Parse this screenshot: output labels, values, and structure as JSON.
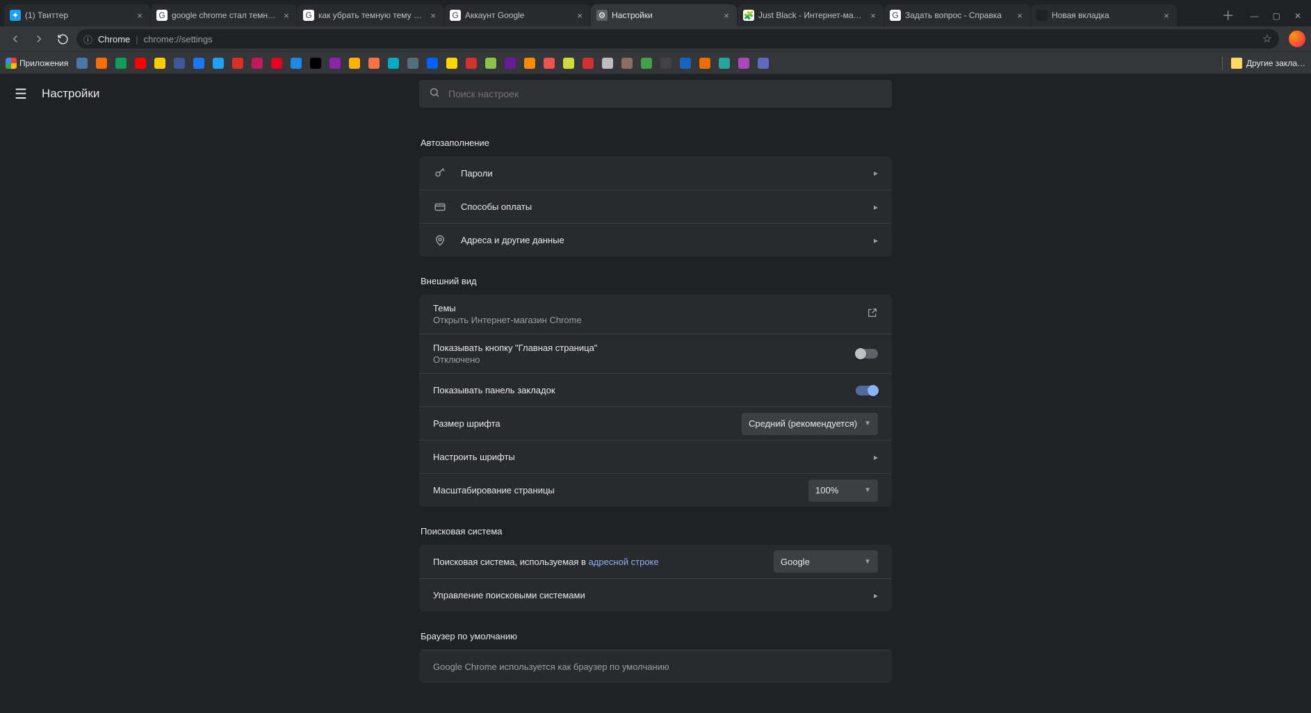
{
  "tabs": [
    {
      "title": "(1) Твиттер",
      "fav_bg": "#1da1f2",
      "fav_glyph": "✦"
    },
    {
      "title": "google chrome стал темн…",
      "fav_bg": "#fff",
      "fav_glyph": "G"
    },
    {
      "title": "как убрать темную тему c…",
      "fav_bg": "#fff",
      "fav_glyph": "G"
    },
    {
      "title": "Аккаунт Google",
      "fav_bg": "#fff",
      "fav_glyph": "G"
    },
    {
      "title": "Настройки",
      "fav_bg": "#5f6368",
      "fav_glyph": "⚙"
    },
    {
      "title": "Just Black - Интернет-мага…",
      "fav_bg": "#fff",
      "fav_glyph": "🧩"
    },
    {
      "title": "Задать вопрос - Справка",
      "fav_bg": "#fff",
      "fav_glyph": "G"
    },
    {
      "title": "Новая вкладка",
      "fav_bg": "#202124",
      "fav_glyph": ""
    }
  ],
  "active_tab_index": 4,
  "omnibox": {
    "secure_label": "Chrome",
    "origin": "",
    "path": "chrome://settings"
  },
  "bookmarks_label": "Приложения",
  "bookmark_icons": [
    "#4a76a8",
    "#ff6d00",
    "#0f9d58",
    "#ff0000",
    "#ffcc00",
    "#3b5998",
    "#1877f2",
    "#1da1f2",
    "#d93025",
    "#c2185b",
    "#e60023",
    "#1e88e5",
    "#000000",
    "#8e24aa",
    "#ffb300",
    "#ff7043",
    "#00acc1",
    "#546e7a",
    "#0061ff",
    "#ffd600",
    "#d32f2f",
    "#8bc34a",
    "#6a1b9a",
    "#fb8c00",
    "#ef5350",
    "#cddc39",
    "#d32f2f",
    "#bdbdbd",
    "#8d6e63",
    "#43a047",
    "#424242",
    "#1565c0",
    "#ef6c00",
    "#26a69a",
    "#ab47bc",
    "#5c6bc0"
  ],
  "other_bookmarks": "Другие закла…",
  "settings": {
    "title": "Настройки",
    "search_placeholder": "Поиск настроек",
    "section_autofill": "Автозаполнение",
    "autofill": {
      "passwords": "Пароли",
      "payment": "Способы оплаты",
      "addresses": "Адреса и другие данные"
    },
    "section_appearance": "Внешний вид",
    "appearance": {
      "themes": "Темы",
      "themes_sub": "Открыть Интернет-магазин Chrome",
      "homebtn": "Показывать кнопку \"Главная страница\"",
      "homebtn_sub": "Отключено",
      "bookmarks_bar": "Показывать панель закладок",
      "font_size": "Размер шрифта",
      "font_size_value": "Средний (рекомендуется)",
      "fonts": "Настроить шрифты",
      "zoom": "Масштабирование страницы",
      "zoom_value": "100%"
    },
    "section_search": "Поисковая система",
    "search": {
      "engine_prefix": "Поисковая система, используемая в ",
      "engine_link": "адресной строке",
      "engine_value": "Google",
      "manage": "Управление поисковыми системами"
    },
    "section_default": "Браузер по умолчанию",
    "default_browser": "Google Chrome используется как браузер по умолчанию"
  }
}
